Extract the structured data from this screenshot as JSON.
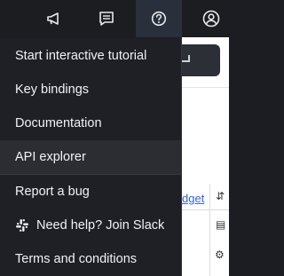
{
  "topbar": {
    "icons": [
      "megaphone-icon",
      "message-icon",
      "help-icon",
      "user-icon"
    ]
  },
  "background": {
    "link_text": "dget"
  },
  "menu": {
    "items": [
      {
        "label": "Start interactive tutorial"
      },
      {
        "label": "Key bindings"
      },
      {
        "label": "Documentation"
      },
      {
        "label": "API explorer"
      },
      {
        "label": "Report a bug"
      },
      {
        "label": "Need help? Join Slack",
        "icon": "slack-icon"
      },
      {
        "label": "Terms and conditions"
      }
    ]
  },
  "colors": {
    "topbar_bg": "#1b1d21",
    "active_button_bg": "#2a2f3c",
    "menu_bg": "#1f2026",
    "hover_bg": "#2c2d33",
    "text": "#f1f2f4",
    "link": "#3a63d8"
  }
}
